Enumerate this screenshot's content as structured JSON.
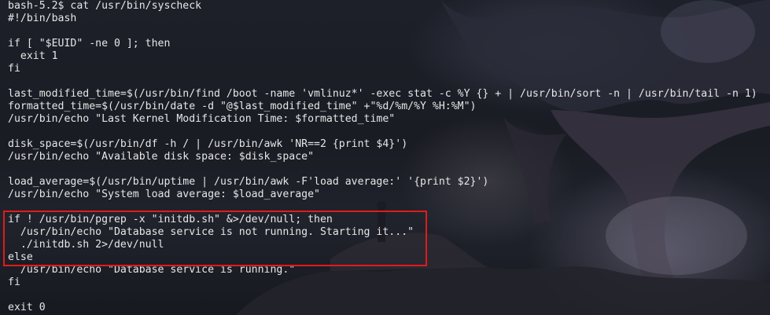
{
  "terminal": {
    "prompt": "bash-5.2$",
    "command": "cat /usr/bin/syscheck",
    "lines": [
      "bash-5.2$ cat /usr/bin/syscheck",
      "#!/bin/bash",
      "",
      "if [ \"$EUID\" -ne 0 ]; then",
      "  exit 1",
      "fi",
      "",
      "last_modified_time=$(/usr/bin/find /boot -name 'vmlinuz*' -exec stat -c %Y {} + | /usr/bin/sort -n | /usr/bin/tail -n 1)",
      "formatted_time=$(/usr/bin/date -d \"@$last_modified_time\" +\"%d/%m/%Y %H:%M\")",
      "/usr/bin/echo \"Last Kernel Modification Time: $formatted_time\"",
      "",
      "disk_space=$(/usr/bin/df -h / | /usr/bin/awk 'NR==2 {print $4}')",
      "/usr/bin/echo \"Available disk space: $disk_space\"",
      "",
      "load_average=$(/usr/bin/uptime | /usr/bin/awk -F'load average:' '{print $2}')",
      "/usr/bin/echo \"System load average: $load_average\"",
      "",
      "if ! /usr/bin/pgrep -x \"initdb.sh\" &>/dev/null; then",
      "  /usr/bin/echo \"Database service is not running. Starting it...\"",
      "  ./initdb.sh 2>/dev/null",
      "else",
      "  /usr/bin/echo \"Database service is running.\"",
      "fi",
      "",
      "exit 0"
    ]
  },
  "colors": {
    "text": "#e6e6e6",
    "highlight_border": "#e01b1b",
    "background": "#171a22"
  }
}
